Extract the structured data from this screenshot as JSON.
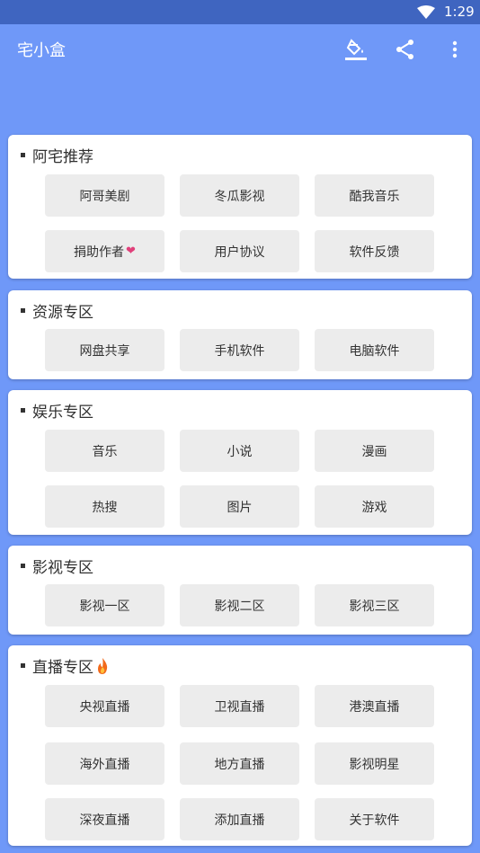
{
  "status_bar": {
    "time": "1:29"
  },
  "app_bar": {
    "title": "宅小盒"
  },
  "sections": [
    {
      "title": "阿宅推荐",
      "buttons": [
        "阿哥美剧",
        "冬瓜影视",
        "酷我音乐",
        "捐助作者",
        "用户协议",
        "软件反馈"
      ]
    },
    {
      "title": "资源专区",
      "buttons": [
        "网盘共享",
        "手机软件",
        "电脑软件"
      ]
    },
    {
      "title": "娱乐专区",
      "buttons": [
        "音乐",
        "小说",
        "漫画",
        "热搜",
        "图片",
        "游戏"
      ]
    },
    {
      "title": "影视专区",
      "buttons": [
        "影视一区",
        "影视二区",
        "影视三区"
      ]
    },
    {
      "title": "直播专区",
      "buttons": [
        "央视直播",
        "卫视直播",
        "港澳直播",
        "海外直播",
        "地方直播",
        "影视明星",
        "深夜直播",
        "添加直播",
        "关于软件"
      ]
    }
  ],
  "colors": {
    "app_bar": "#6f98f8",
    "status_bar": "#3f65c0",
    "button": "#ececec",
    "heart": "#e0407a"
  },
  "icons": [
    "wifi-icon",
    "paint-bucket-icon",
    "share-icon",
    "more-vert-icon",
    "heart-icon",
    "fire-icon"
  ]
}
